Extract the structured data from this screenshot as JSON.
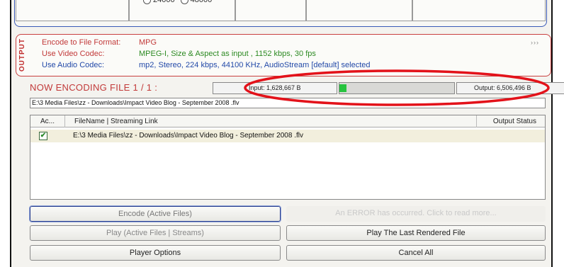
{
  "top_panel": {
    "radio_options": [
      "24000",
      "48000"
    ]
  },
  "output": {
    "tab_label": "OUTPUT",
    "format_label": "Encode to File Format:",
    "format_value": "MPG",
    "video_label": "Use Video Codec:",
    "video_value": "MPEG-I,  Size & Aspect as input ,  1152 kbps,  30 fps",
    "audio_label": "Use Audio Codec:",
    "audio_value": "mp2,  Stereo,  224 kbps,  44100 KHz,  AudioStream [default] selected",
    "more_arrows": "›››"
  },
  "encoding": {
    "status_text": "NOW ENCODING FILE 1 / 1 :",
    "input_text": "Input: 1,628,667 B",
    "progress_fraction": 0.06,
    "progress_color": "#27c33f",
    "output_text": "Output: 6,506,496 B"
  },
  "current_path": "E:\\3 Media Files\\zz - Downloads\\Impact Video Blog - September 2008 .flv",
  "file_table": {
    "headers": {
      "active": "Ac...",
      "file": "FileName  |  Streaming Link",
      "status": "Output Status"
    },
    "rows": [
      {
        "checked": true,
        "check_glyph": "✔",
        "name": "E:\\3 Media Files\\zz - Downloads\\Impact Video Blog - September 2008 .flv",
        "status": ""
      }
    ]
  },
  "buttons": {
    "encode": "Encode (Active Files)",
    "error": "An ERROR has occurred. Click to read more...",
    "play_active": "Play (Active Files | Streams)",
    "play_last": "Play The Last Rendered File",
    "player_options": "Player Options",
    "cancel_all": "Cancel All"
  },
  "colors": {
    "accent_red": "#c23a3a",
    "annotation_red": "#e3121a",
    "panel_blue": "#3a5ab8",
    "codec_green": "#2d8a23"
  }
}
